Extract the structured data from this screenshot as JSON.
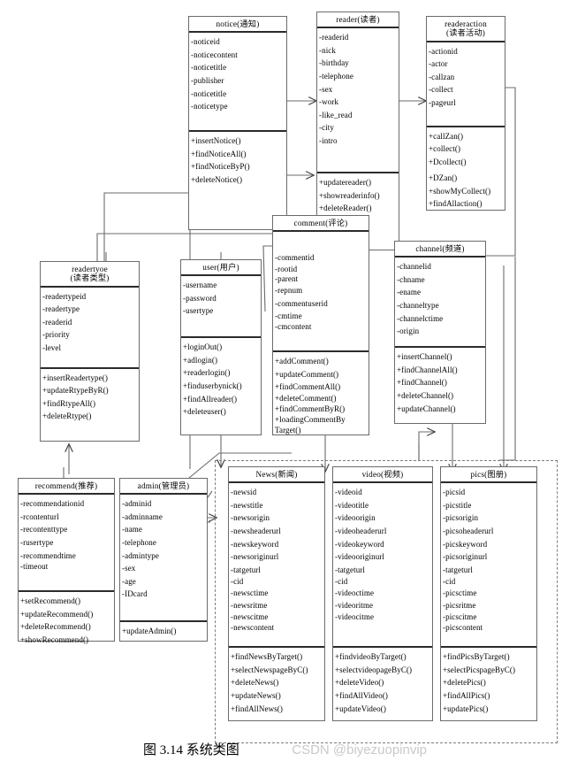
{
  "diagram": {
    "caption": "图 3.14 系统类图",
    "watermark": "CSDN @biyezuopinvip",
    "line_color": "#6b6b6b"
  },
  "classes": {
    "notice": {
      "title": "notice(通知)",
      "attrs": [
        "-noticeid",
        "-noticecontent",
        "-noticetitle",
        "-publisher",
        "-noticetitle",
        "-noticetype"
      ],
      "ops": [
        "+insertNotice()",
        "+findNoticeAll()",
        "+findNoticeByP()",
        "+deleteNotice()"
      ]
    },
    "reader": {
      "title": "reader(读者)",
      "attrs": [
        "-readerid",
        "-nick",
        "-birthday",
        "-telephone",
        "-sex",
        "-work",
        "-like_read",
        "-city",
        "-intro"
      ],
      "ops": [
        "+updatereader()",
        "+showreaderinfo()",
        "+deleteReader()"
      ]
    },
    "readeraction": {
      "title": "readeraction\n(读者活动)",
      "title_line1": "readeraction",
      "title_line2": "(读者活动)",
      "attrs": [
        "-actionid",
        "-actor",
        "-callzan",
        "-collect",
        "-pageurl"
      ],
      "ops": [
        "+callZan()",
        "+collect()",
        "+Dcollect()",
        "+DZan()",
        "+showMyCollect()",
        "+findAllaction()"
      ]
    },
    "readertype": {
      "title_line1": "readertyoe",
      "title_line2": "(读者类型)",
      "attrs": [
        "-readertypeid",
        "-readertype",
        "-readerid",
        "-priority",
        "-level"
      ],
      "ops": [
        "+insertReadertype()",
        "+updateRtypeByR()",
        "+findRtypeAll()",
        "+deleteRtype()"
      ]
    },
    "user": {
      "title": "user(用户)",
      "attrs": [
        "-username",
        "-password",
        "-usertype"
      ],
      "ops": [
        "+loginOut()",
        "+adlogin()",
        "+readerlogin()",
        "+finduserbynick()",
        "+findAllreader()",
        "+deleteuser()"
      ]
    },
    "comment": {
      "title": "comment(评论)",
      "attrs": [
        "-commentid",
        "-rootid",
        "-parent",
        "-repnum",
        "-commentuserid",
        "-cmtime",
        "-cmcontent"
      ],
      "ops": [
        "+addComment()",
        "+updateComment()",
        "+findCommentAll()",
        "+deleteComment()",
        "+findCommentByR()",
        "+loadingCommentBy",
        "Target()"
      ]
    },
    "channel": {
      "title": "channel(频道)",
      "attrs": [
        "-channelid",
        "-chname",
        "-ename",
        "-channeltype",
        "-channelctime",
        "-origin"
      ],
      "ops": [
        "+insertChannel()",
        "+findChannelAll()",
        "+findChannel()",
        "+deleteChannel()",
        "+updateChannel()"
      ]
    },
    "recommend": {
      "title": "recommend(推荐)",
      "attrs": [
        "-recommendationid",
        "-rcontenturl",
        "-recontenttype",
        "-rusertype",
        "-recommendtime",
        "-timeout"
      ],
      "ops": [
        "+setRecommend()",
        "+updateRecommend()",
        "+deleteRecommend()",
        "+showRecommend()"
      ]
    },
    "admin": {
      "title": "admin(管理员)",
      "attrs": [
        "-adminid",
        "-adminname",
        "-name",
        "-telephone",
        "-admintype",
        "-sex",
        "-age",
        "-IDcard"
      ],
      "ops": [
        "+updateAdmin()"
      ]
    },
    "news": {
      "title": "News(新闻)",
      "attrs": [
        "-newsid",
        "-newstitle",
        "-newsorigin",
        "-newsheaderurl",
        "-newskeyword",
        "-newsoriginurl",
        "-tatgeturl",
        "-cid",
        "-newsctime",
        "-newsritme",
        "-newscitme",
        "-newscontent"
      ],
      "ops": [
        "+findNewsByTarget()",
        "+selectNewspageByC()",
        "+deleteNews()",
        "+updateNews()",
        "+findAllNews()"
      ]
    },
    "video": {
      "title": "video(视频)",
      "attrs": [
        "-videoid",
        "-videotitle",
        "-videoorigin",
        "-videoheaderurl",
        "-videokeyword",
        "-videooriginurl",
        "-tatgeturl",
        "-cid",
        "-videoctime",
        "-videoritme",
        "-videocitme"
      ],
      "ops": [
        "+findvideoByTarget()",
        "+selectvideopageByC()",
        "+deleteVideo()",
        "+findAllVideo()",
        "+updateVideo()"
      ]
    },
    "pics": {
      "title": "pics(图册)",
      "attrs": [
        "-picsid",
        "-picstitle",
        "-picsorigin",
        "-picsoheaderurl",
        "-picskeyword",
        "-picsoriginurl",
        "-tatgeturl",
        "-cid",
        "-picsctime",
        "-picsritme",
        "-picscitme",
        "-picscontent"
      ],
      "ops": [
        "+findPicsByTarget()",
        "+selectPicspageByC()",
        "+deletePics()",
        "+findAllPics()",
        "+updatePics()"
      ]
    }
  }
}
